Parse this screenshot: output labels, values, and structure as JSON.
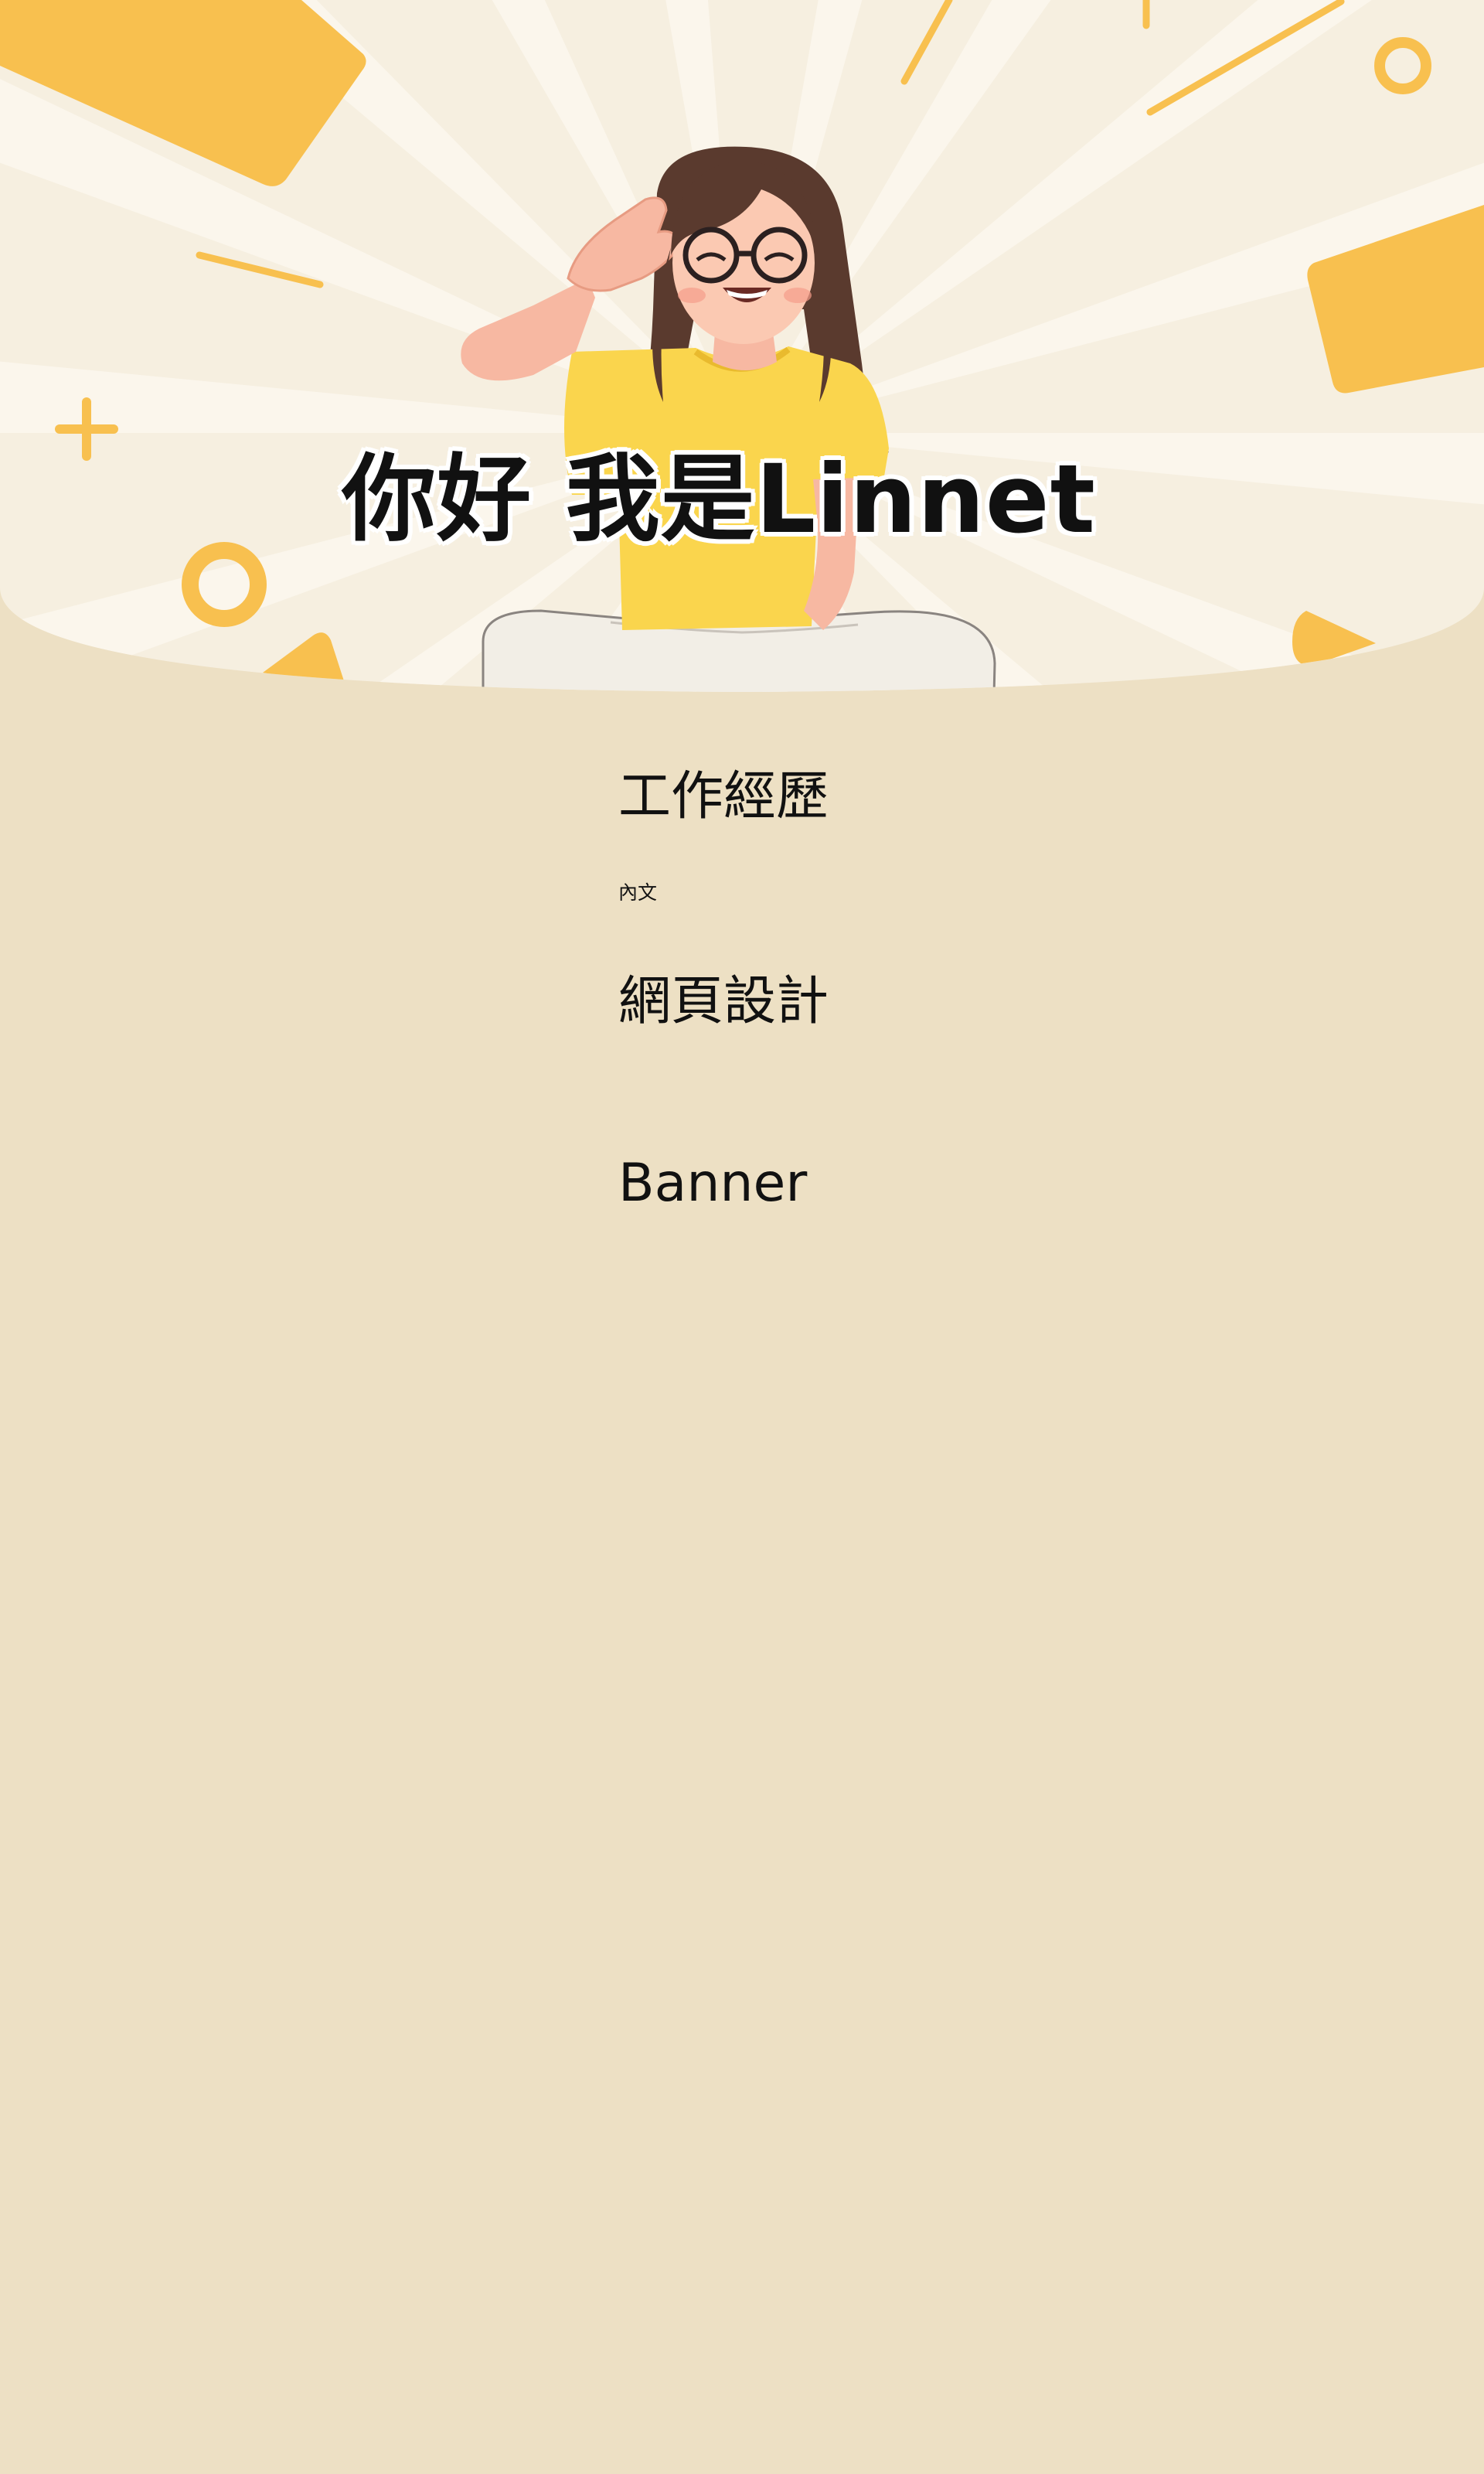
{
  "hero": {
    "title": "你好 我是Linnet",
    "illustration_icon": "waving-girl-illustration",
    "colors": {
      "background": "#f6efe0",
      "rays": "#fbf6ec",
      "accent": "#f8c04f",
      "page_background": "#ede0c4"
    }
  },
  "sections": {
    "work_experience": {
      "title": "工作經歷",
      "body": "內文"
    },
    "web_design": {
      "title": "網頁設計"
    },
    "banner": {
      "title": "Banner"
    }
  }
}
